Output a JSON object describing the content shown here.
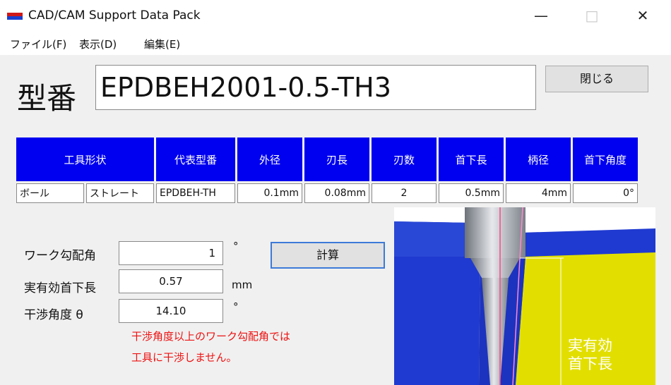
{
  "window": {
    "title": "CAD/CAM Support Data Pack",
    "minimize": "—",
    "maximize": "□",
    "close": "✕"
  },
  "menu": [
    "ファイル(F)",
    "表示(D)",
    "編集(E)"
  ],
  "model": {
    "label": "型番",
    "value": "EPDBEH2001-0.5-TH3",
    "close_button": "閉じる"
  },
  "spec_table": {
    "headers": [
      "工具形状",
      "代表型番",
      "外径",
      "刃長",
      "刃数",
      "首下長",
      "柄径",
      "首下角度"
    ],
    "row": [
      "ボール",
      "ストレート",
      "EPDBEH-TH",
      "0.1mm",
      "0.08mm",
      "2",
      "0.5mm",
      "4mm",
      "0°"
    ]
  },
  "calc": {
    "work_angle_label": "ワーク勾配角",
    "work_angle_value": "1",
    "work_angle_unit": "°",
    "effective_length_label": "実有効首下長",
    "effective_length_value": "0.57",
    "effective_length_unit": "mm",
    "interference_label": "干渉角度 θ",
    "interference_value": "14.10",
    "interference_unit": "°",
    "calc_button": "計算",
    "note_line1": "干渉角度以上のワーク勾配角では",
    "note_line2": "工具に干渉しません。"
  },
  "diagram": {
    "label_line1": "実有効",
    "label_line2": "首下長",
    "colors": {
      "blue": "#1f3ad0",
      "yellow": "#e2df00",
      "tool": "#b8bcc4"
    }
  }
}
